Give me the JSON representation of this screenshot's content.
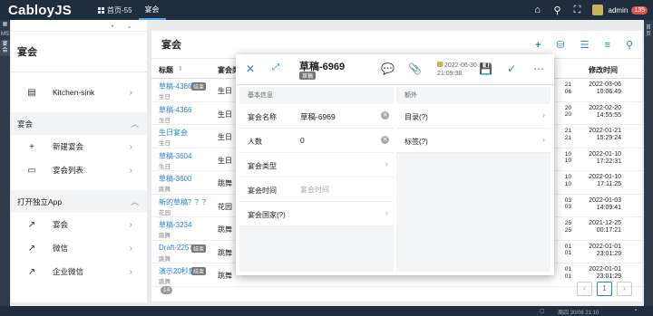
{
  "app": {
    "logo": "CabloyJS"
  },
  "topbar": {
    "tabs": [
      {
        "label": "首页-55",
        "active": false
      },
      {
        "label": "宴会",
        "active": true
      }
    ],
    "icons": [
      "home-icon",
      "search-icon",
      "fullscreen-icon"
    ],
    "user": "admin",
    "notify_count": "135"
  },
  "rail": {
    "items": [
      "MS",
      "宴会"
    ]
  },
  "right_rail": {
    "label": "首页"
  },
  "sidebar": {
    "title": "宴会",
    "top_items": [
      {
        "label": "Kitchen-sink",
        "icon": "kitchen-icon"
      }
    ],
    "group1": {
      "label": "宴会"
    },
    "group1_items": [
      {
        "label": "新建宴会",
        "icon": "plus-icon"
      },
      {
        "label": "宴会列表",
        "icon": "list-icon"
      }
    ],
    "group2": {
      "label": "打开独立App"
    },
    "group2_items": [
      {
        "label": "宴会",
        "icon": "external-link-icon"
      },
      {
        "label": "微信",
        "icon": "external-link-icon"
      },
      {
        "label": "企业微信",
        "icon": "external-link-icon"
      }
    ]
  },
  "main": {
    "title": "宴会",
    "columns": {
      "title": "标题",
      "type": "宴会类",
      "mid": "",
      "mtime": "修改时间"
    },
    "rows": [
      {
        "title": "草稿-4386",
        "tag": "结束",
        "sub": "生日",
        "type": "生日",
        "mid": "21\n06",
        "time": "2022-03-06\n10:06:49"
      },
      {
        "title": "草稿-4366",
        "tag": "",
        "sub": "生日",
        "type": "生日",
        "mid": "20\n20",
        "time": "2022-02-20\n14:55:55"
      },
      {
        "title": "生日宴会",
        "tag": "",
        "sub": "生日",
        "type": "生日",
        "mid": "21\n21",
        "time": "2022-01-21\n15:29:24"
      },
      {
        "title": "草稿-3604",
        "tag": "",
        "sub": "生日",
        "type": "生日",
        "mid": "10\n10",
        "time": "2022-01-10\n17:22:31"
      },
      {
        "title": "草稿-3600",
        "tag": "",
        "sub": "跳舞",
        "type": "跳舞",
        "mid": "10\n10",
        "time": "2022-01-10\n17:11:25"
      },
      {
        "title": "新的草稿？？？",
        "tag": "",
        "sub": "花园",
        "type": "花园",
        "mid": "03\n03",
        "time": "2022-01-03\n14:09:41"
      },
      {
        "title": "草稿-3234",
        "tag": "",
        "sub": "跳舞",
        "type": "跳舞",
        "mid": "25\n25",
        "time": "2021-12-25\n00:17:21"
      },
      {
        "title": "Draft-2257",
        "tag": "结束",
        "sub": "跳舞",
        "type": "跳舞",
        "mid": "01\n01",
        "time": "2022-01-01\n23:01:29"
      },
      {
        "title": "演示20秒后",
        "tag": "结束",
        "sub": "跳舞",
        "type": "跳舞",
        "mid": "01\n01",
        "time": "2022-01-01\n23:01:29"
      }
    ],
    "count": "14",
    "page": "1"
  },
  "modal": {
    "title": "草稿-6969",
    "status": "草稿",
    "date": "2022-06-30",
    "time": "21:09:38",
    "basic_section": "基本信息",
    "extra_section": "额外",
    "fields": [
      {
        "label": "宴会名称",
        "value": "草稿-6969",
        "clear": true,
        "chev": false,
        "placeholder": false
      },
      {
        "label": "人数",
        "value": "0",
        "clear": true,
        "chev": false,
        "placeholder": false
      },
      {
        "label": "宴会类型",
        "value": "",
        "clear": false,
        "chev": true,
        "placeholder": false
      },
      {
        "label": "宴会时间",
        "value": "宴会时间",
        "clear": false,
        "chev": false,
        "placeholder": true
      },
      {
        "label": "宴会国家(?)",
        "value": "",
        "clear": false,
        "chev": true,
        "placeholder": false
      }
    ],
    "extra_fields": [
      {
        "label": "目录(?)"
      },
      {
        "label": "标签(?)"
      }
    ]
  },
  "bottombar": {
    "text": "周四 30/06 21:10"
  }
}
